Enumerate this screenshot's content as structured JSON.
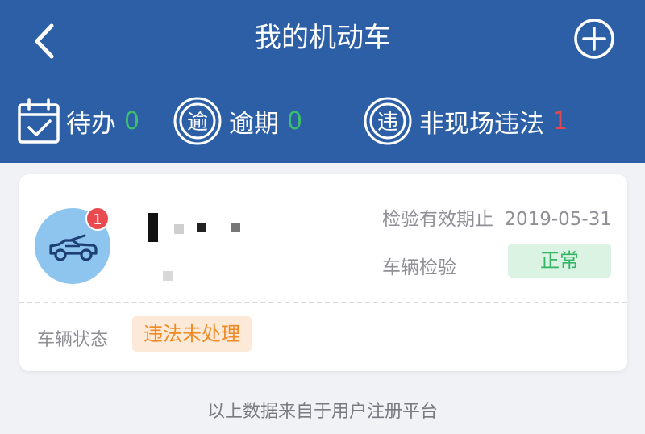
{
  "header": {
    "title": "我的机动车",
    "back_icon": "chevron-left-icon",
    "add_icon": "plus-circle-icon",
    "background_color": "#2c5fa6"
  },
  "stats": [
    {
      "icon": "calendar-check-icon",
      "label": "待办",
      "count": "0",
      "count_color": "#3bbf6e"
    },
    {
      "icon": "overdue-icon",
      "label": "逾期",
      "count": "0",
      "count_color": "#3bbf6e"
    },
    {
      "icon": "violation-icon",
      "label": "非现场违法",
      "count": "1",
      "count_color": "#e2474b"
    }
  ],
  "vehicle": {
    "icon": "car-icon",
    "badge_count": "1",
    "inspection_date_label": "检验有效期止",
    "inspection_date": "2019-05-31",
    "inspection_label": "车辆检验",
    "inspection_status": "正常",
    "state_label": "车辆状态",
    "state_value": "违法未处理"
  },
  "footer": {
    "note": "以上数据来自于用户注册平台"
  }
}
